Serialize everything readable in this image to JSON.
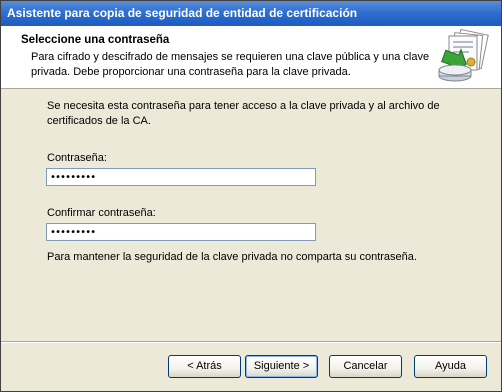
{
  "window": {
    "title": "Asistente para copia de seguridad de entidad de certificación"
  },
  "header": {
    "title": "Seleccione una contraseña",
    "subtitle": "Para cifrado y descifrado de mensajes se requieren una clave pública y una clave privada. Debe proporcionar una contraseña para la clave privada.",
    "icon": "certificate-backup-icon"
  },
  "main": {
    "intro": "Se necesita esta contraseña para tener acceso a la clave privada y al archivo de certificados de la CA.",
    "password_label": "Contraseña:",
    "password_value": "•••••••••",
    "confirm_label": "Confirmar contraseña:",
    "confirm_value": "•••••••••",
    "note": "Para mantener la seguridad de la clave privada no comparta su contraseña."
  },
  "buttons": {
    "back": "< Atrás",
    "next": "Siguiente >",
    "cancel": "Cancelar",
    "help": "Ayuda"
  },
  "colors": {
    "titlebar": "#2f6fcf",
    "dialog_bg": "#ece9d8",
    "header_bg": "#ffffff"
  }
}
